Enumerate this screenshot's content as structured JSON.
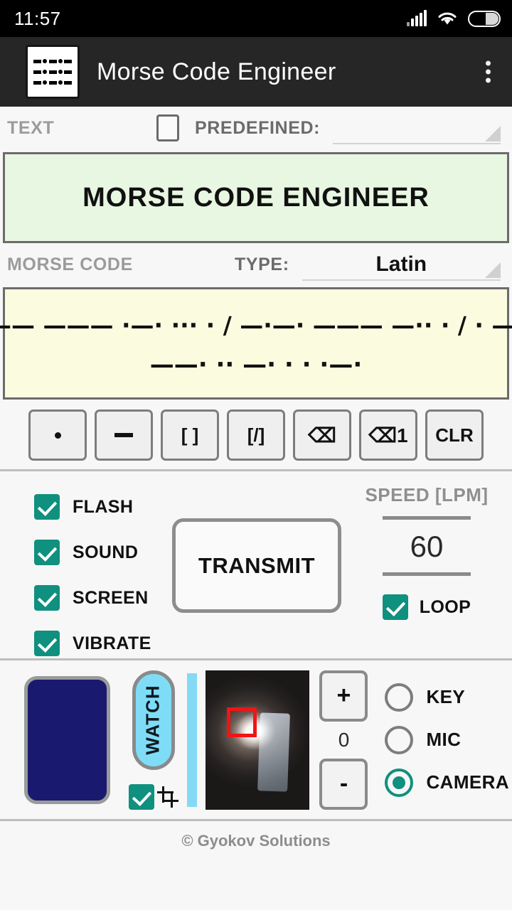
{
  "status_bar": {
    "clock": "11:57",
    "signal_icon": "signal-bars-icon",
    "wifi_icon": "wifi-icon",
    "battery_icon": "battery-icon"
  },
  "app_bar": {
    "title": "Morse Code Engineer",
    "logo_icon": "morse-grid-logo-icon",
    "overflow_icon": "overflow-menu-icon"
  },
  "text_section": {
    "label": "TEXT",
    "predefined_label": "PREDEFINED:",
    "predefined_checked": false,
    "predefined_value": "",
    "text_value": "MORSE CODE ENGINEER",
    "text_bg_color": "#e8f7e2"
  },
  "morse_section": {
    "label": "MORSE CODE",
    "type_label": "TYPE:",
    "type_value": "Latin",
    "morse_line_1": "—— ——— ·—· ··· · / —·—· ——— —·· · / · —·",
    "morse_line_2": "——· ·· —· · · ·—·",
    "morse_bg_color": "#fbfbdf"
  },
  "keypad": {
    "keys": [
      {
        "name": "dot-key",
        "label": "",
        "glyph": "dot"
      },
      {
        "name": "dash-key",
        "label": "",
        "glyph": "dash"
      },
      {
        "name": "letter-space-key",
        "label": "[ ]",
        "glyph": "text"
      },
      {
        "name": "word-space-key",
        "label": "[/]",
        "glyph": "text"
      },
      {
        "name": "backspace-key",
        "label": "⌫",
        "glyph": "text"
      },
      {
        "name": "backspace-one-key",
        "label": "⌫1",
        "glyph": "text"
      },
      {
        "name": "clear-key",
        "label": "CLR",
        "glyph": "text"
      }
    ]
  },
  "options": {
    "checkboxes": [
      {
        "name": "flash-checkbox",
        "label": "FLASH",
        "checked": true
      },
      {
        "name": "sound-checkbox",
        "label": "SOUND",
        "checked": true
      },
      {
        "name": "screen-checkbox",
        "label": "SCREEN",
        "checked": true
      },
      {
        "name": "vibrate-checkbox",
        "label": "VIBRATE",
        "checked": true
      }
    ],
    "transmit_label": "TRANSMIT",
    "speed_title": "SPEED [LPM]",
    "speed_value": "60",
    "loop_label": "LOOP",
    "loop_checked": true,
    "accent_color": "#10907e"
  },
  "bottom": {
    "flash_panel_color": "#191970",
    "watch_label": "WATCH",
    "watch_color": "#7fdcf7",
    "crop_checkbox_checked": true,
    "crop_icon": "crop-icon",
    "slider_color": "#84d9f5",
    "camera_preview_name": "camera-preview",
    "selection_rect_color": "#f21414",
    "plus_label": "+",
    "minus_label": "-",
    "zoom_value": "0",
    "radios": [
      {
        "name": "key-radio",
        "label": "KEY",
        "selected": false
      },
      {
        "name": "mic-radio",
        "label": "MIC",
        "selected": false
      },
      {
        "name": "camera-radio",
        "label": "CAMERA",
        "selected": true
      }
    ]
  },
  "footer": {
    "copyright": "© Gyokov Solutions"
  }
}
